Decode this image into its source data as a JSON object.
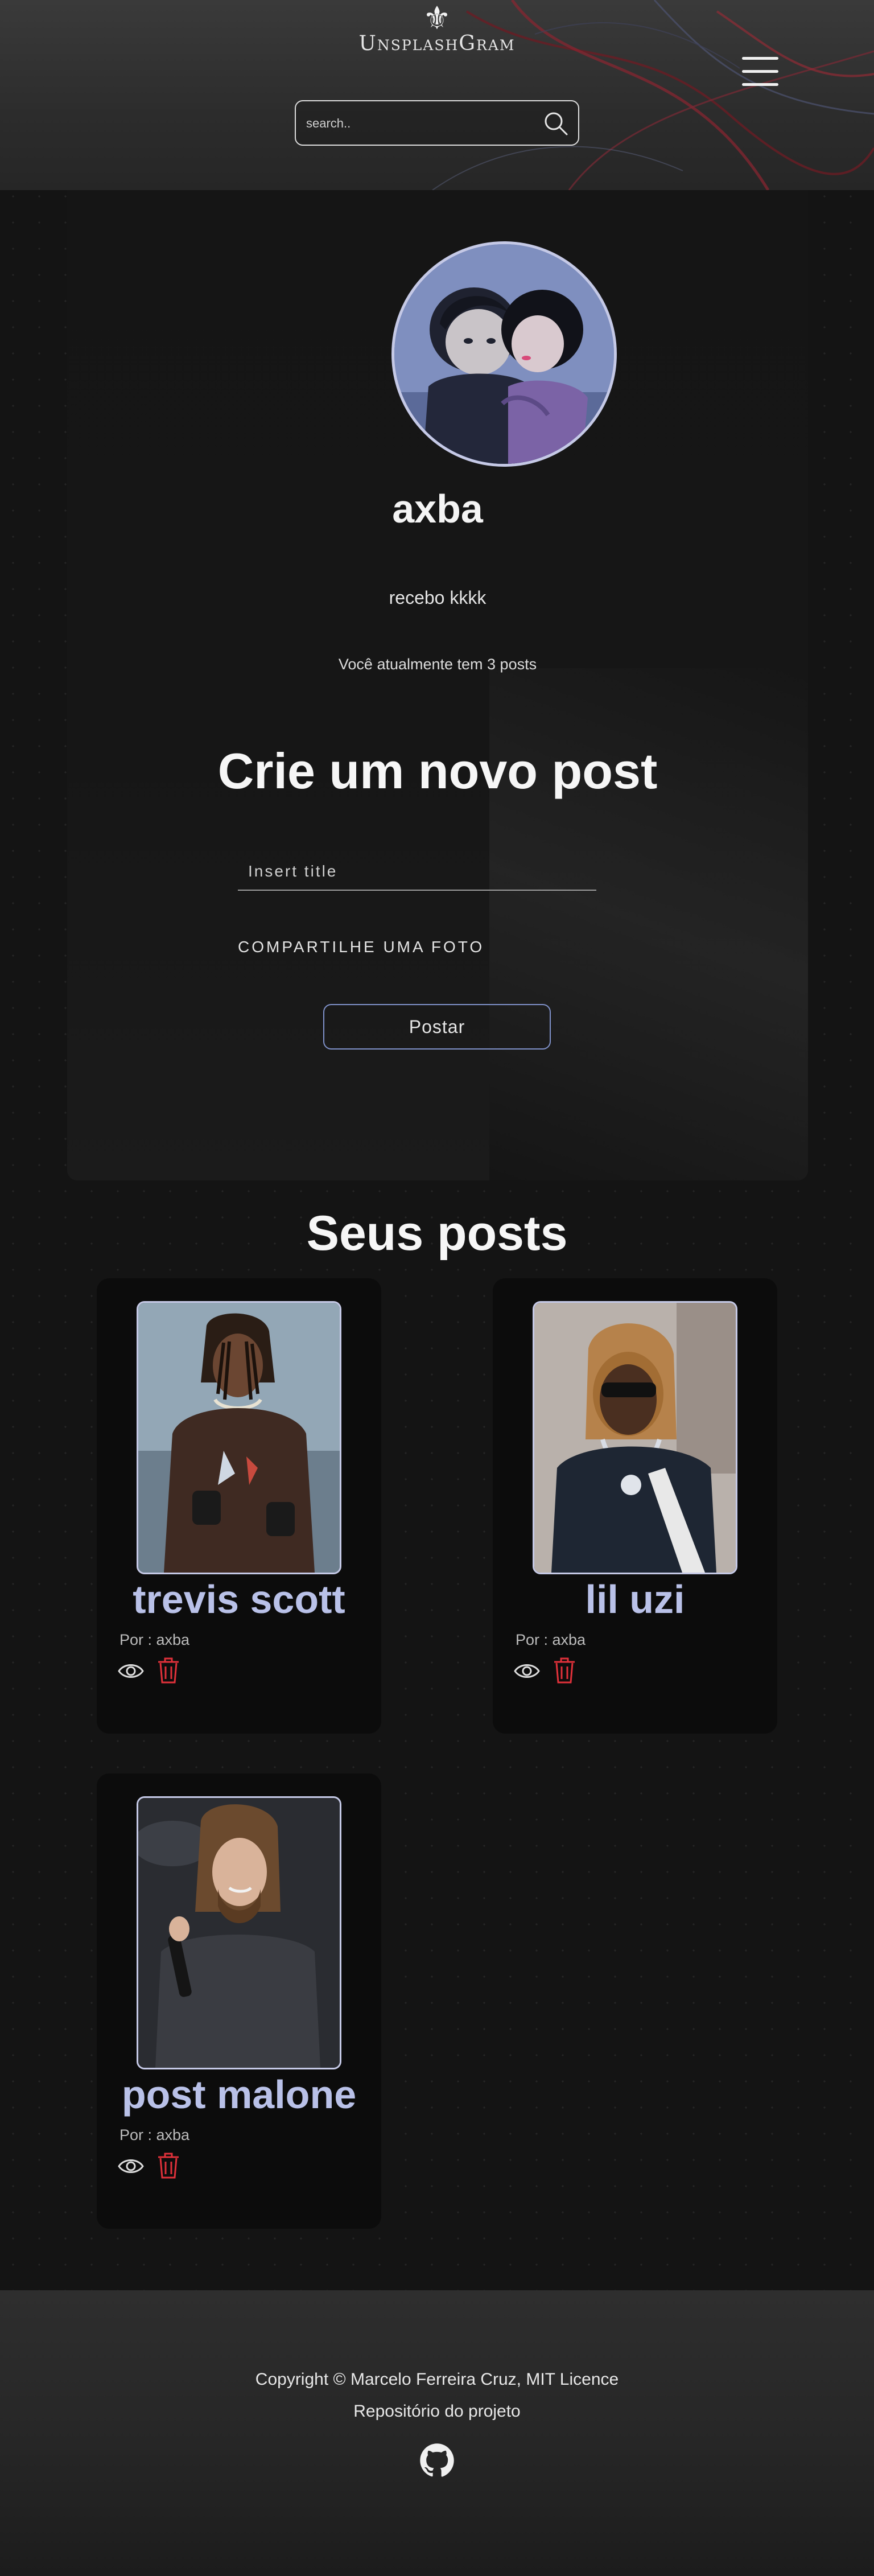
{
  "header": {
    "logo_glyph": "⚜",
    "logo_text": "UnsplashGram",
    "search_placeholder": "search..",
    "search_value": ""
  },
  "profile": {
    "username": "axba",
    "bio": "recebo kkkk",
    "post_count_text": "Você atualmente tem 3 posts"
  },
  "new_post": {
    "heading": "Crie um novo post",
    "title_placeholder": "Insert title",
    "title_value": "",
    "share_label": "COMPARTILHE UMA FOTO",
    "submit_label": "Postar"
  },
  "posts_section": {
    "heading": "Seus posts",
    "posts": [
      {
        "title": "trevis scott",
        "author": "Por : axba"
      },
      {
        "title": "lil uzi",
        "author": "Por : axba"
      },
      {
        "title": "post malone",
        "author": "Por : axba"
      }
    ]
  },
  "footer": {
    "copyright": "Copyright © Marcelo Ferreira Cruz, MIT Licence",
    "repo_link": "Repositório do projeto"
  },
  "colors": {
    "accent": "#b9c1e8",
    "delete": "#e0313a",
    "background": "#141414"
  },
  "icons": [
    "fleur-de-lis-icon",
    "search-icon",
    "menu-icon",
    "eye-icon",
    "trash-icon",
    "github-icon"
  ]
}
